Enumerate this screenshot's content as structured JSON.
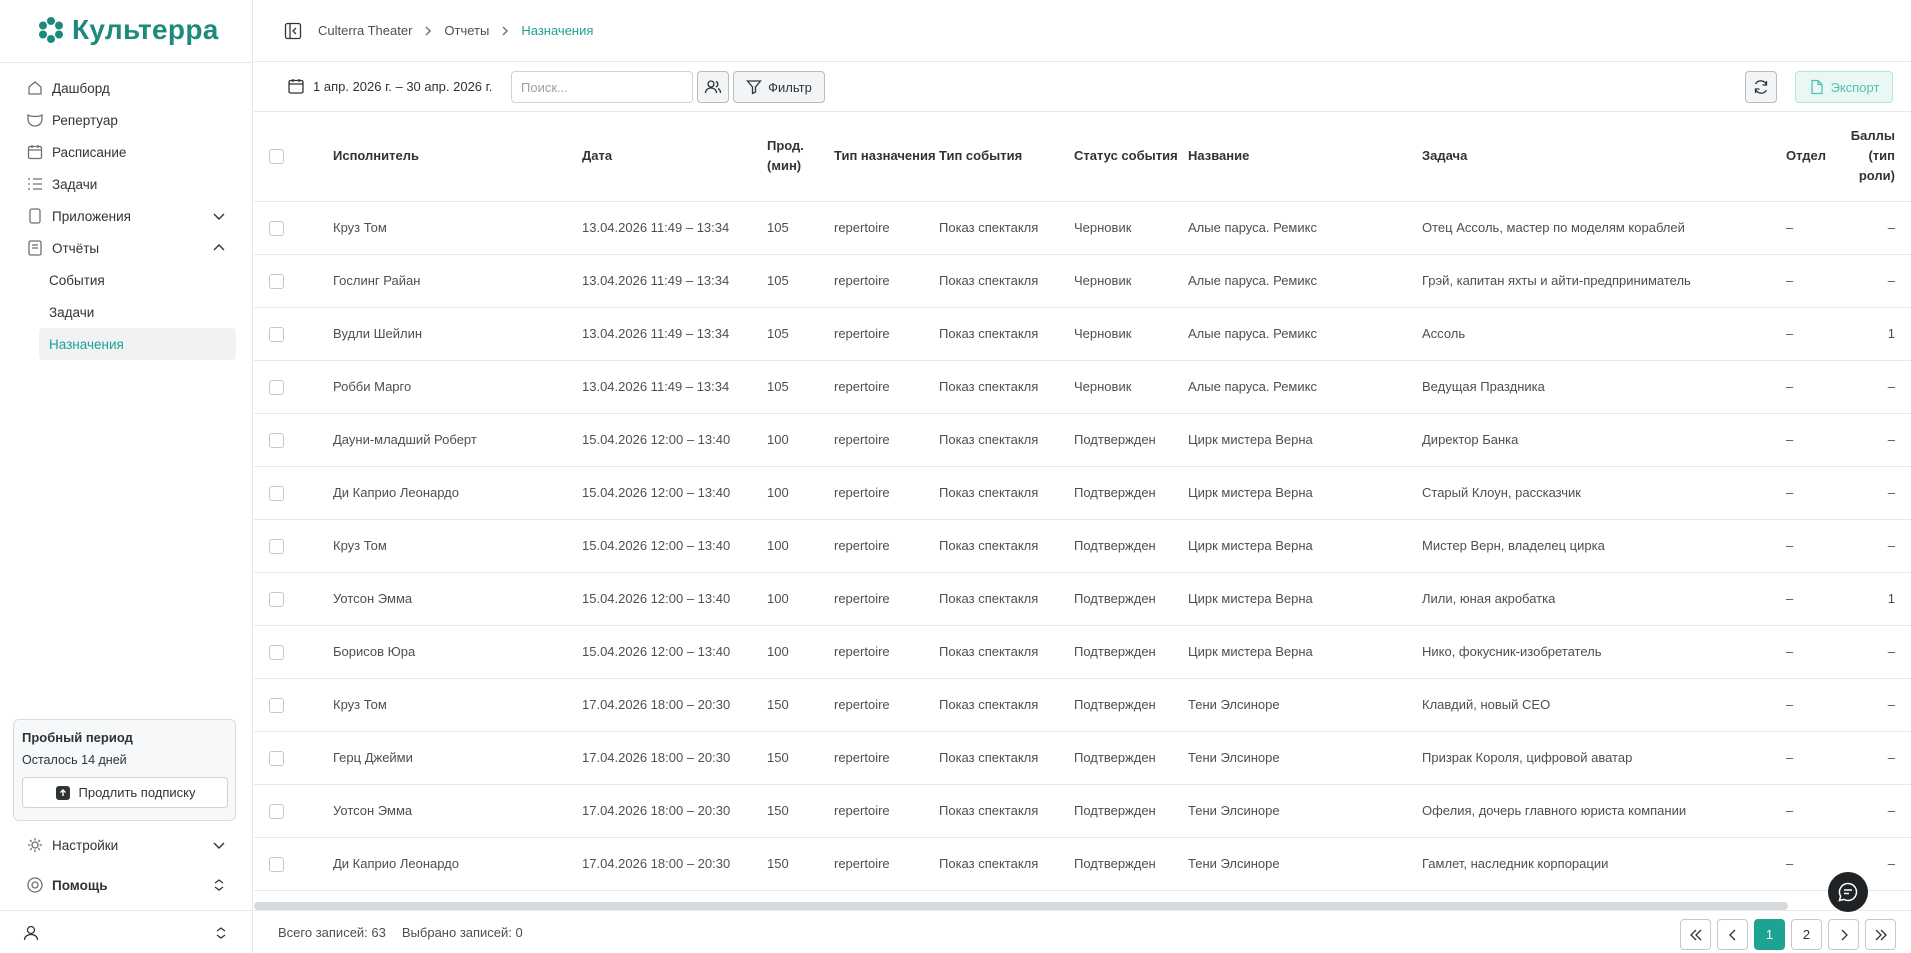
{
  "brand": {
    "name": "Культерра",
    "color": "#1e8a7c"
  },
  "sidebar": {
    "items": [
      {
        "label": "Дашборд",
        "icon": "home-icon"
      },
      {
        "label": "Репертуар",
        "icon": "theater-icon"
      },
      {
        "label": "Расписание",
        "icon": "calendar-icon"
      },
      {
        "label": "Задачи",
        "icon": "tasks-icon"
      },
      {
        "label": "Приложения",
        "icon": "app-icon"
      },
      {
        "label": "Отчёты",
        "icon": "report-icon"
      }
    ],
    "reports_sub": [
      {
        "label": "События"
      },
      {
        "label": "Задачи"
      },
      {
        "label": "Назначения"
      }
    ],
    "trial": {
      "title": "Пробный период",
      "days": "Осталось 14 дней",
      "button": "Продлить подписку"
    },
    "settings_label": "Настройки",
    "help_label": "Помощь"
  },
  "breadcrumb": [
    "Culterra Theater",
    "Отчеты",
    "Назначения"
  ],
  "toolbar": {
    "date_range": "1 апр. 2026 г. – 30 апр. 2026 г.",
    "search_placeholder": "Поиск...",
    "filter_label": "Фильтр",
    "export_label": "Экспорт"
  },
  "table": {
    "headers": {
      "performer": "Исполнитель",
      "date": "Дата",
      "duration": "Прод. (мин)",
      "assign_type": "Тип назначения",
      "event_type": "Тип события",
      "event_status": "Статус события",
      "name": "Название",
      "task": "Задача",
      "dept": "Отдел",
      "points": "Баллы (тип роли)"
    },
    "rows": [
      {
        "performer": "Круз Том",
        "date": "13.04.2026 11:49 – 13:34",
        "duration": "105",
        "assign_type": "repertoire",
        "event_type": "Показ спектакля",
        "event_status": "Черновик",
        "name": "Алые паруса. Ремикс",
        "task": "Отец Ассоль, мастер по моделям кораблей",
        "dept": "–",
        "points": "–"
      },
      {
        "performer": "Гослинг Райан",
        "date": "13.04.2026 11:49 – 13:34",
        "duration": "105",
        "assign_type": "repertoire",
        "event_type": "Показ спектакля",
        "event_status": "Черновик",
        "name": "Алые паруса. Ремикс",
        "task": "Грэй, капитан яхты и айти-предприниматель",
        "dept": "–",
        "points": "–"
      },
      {
        "performer": "Вудли Шейлин",
        "date": "13.04.2026 11:49 – 13:34",
        "duration": "105",
        "assign_type": "repertoire",
        "event_type": "Показ спектакля",
        "event_status": "Черновик",
        "name": "Алые паруса. Ремикс",
        "task": "Ассоль",
        "dept": "–",
        "points": "1"
      },
      {
        "performer": "Робби Марго",
        "date": "13.04.2026 11:49 – 13:34",
        "duration": "105",
        "assign_type": "repertoire",
        "event_type": "Показ спектакля",
        "event_status": "Черновик",
        "name": "Алые паруса. Ремикс",
        "task": "Ведущая Праздника",
        "dept": "–",
        "points": "–"
      },
      {
        "performer": "Дауни-младший Роберт",
        "date": "15.04.2026 12:00 – 13:40",
        "duration": "100",
        "assign_type": "repertoire",
        "event_type": "Показ спектакля",
        "event_status": "Подтвержден",
        "name": "Цирк мистера Верна",
        "task": "Директор Банка",
        "dept": "–",
        "points": "–"
      },
      {
        "performer": "Ди Каприо Леонардо",
        "date": "15.04.2026 12:00 – 13:40",
        "duration": "100",
        "assign_type": "repertoire",
        "event_type": "Показ спектакля",
        "event_status": "Подтвержден",
        "name": "Цирк мистера Верна",
        "task": "Старый Клоун, рассказчик",
        "dept": "–",
        "points": "–"
      },
      {
        "performer": "Круз Том",
        "date": "15.04.2026 12:00 – 13:40",
        "duration": "100",
        "assign_type": "repertoire",
        "event_type": "Показ спектакля",
        "event_status": "Подтвержден",
        "name": "Цирк мистера Верна",
        "task": "Мистер Верн, владелец цирка",
        "dept": "–",
        "points": "–"
      },
      {
        "performer": "Уотсон Эмма",
        "date": "15.04.2026 12:00 – 13:40",
        "duration": "100",
        "assign_type": "repertoire",
        "event_type": "Показ спектакля",
        "event_status": "Подтвержден",
        "name": "Цирк мистера Верна",
        "task": "Лили, юная акробатка",
        "dept": "–",
        "points": "1"
      },
      {
        "performer": "Борисов Юра",
        "date": "15.04.2026 12:00 – 13:40",
        "duration": "100",
        "assign_type": "repertoire",
        "event_type": "Показ спектакля",
        "event_status": "Подтвержден",
        "name": "Цирк мистера Верна",
        "task": "Нико, фокусник-изобретатель",
        "dept": "–",
        "points": "–"
      },
      {
        "performer": "Круз Том",
        "date": "17.04.2026 18:00 – 20:30",
        "duration": "150",
        "assign_type": "repertoire",
        "event_type": "Показ спектакля",
        "event_status": "Подтвержден",
        "name": "Тени Элсиноре",
        "task": "Клавдий, новый CEO",
        "dept": "–",
        "points": "–"
      },
      {
        "performer": "Герц Джейми",
        "date": "17.04.2026 18:00 – 20:30",
        "duration": "150",
        "assign_type": "repertoire",
        "event_type": "Показ спектакля",
        "event_status": "Подтвержден",
        "name": "Тени Элсиноре",
        "task": "Призрак Короля, цифровой аватар",
        "dept": "–",
        "points": "–"
      },
      {
        "performer": "Уотсон Эмма",
        "date": "17.04.2026 18:00 – 20:30",
        "duration": "150",
        "assign_type": "repertoire",
        "event_type": "Показ спектакля",
        "event_status": "Подтвержден",
        "name": "Тени Элсиноре",
        "task": "Офелия, дочерь главного юриста компании",
        "dept": "–",
        "points": "–"
      },
      {
        "performer": "Ди Каприо Леонардо",
        "date": "17.04.2026 18:00 – 20:30",
        "duration": "150",
        "assign_type": "repertoire",
        "event_type": "Показ спектакля",
        "event_status": "Подтвержден",
        "name": "Тени Элсиноре",
        "task": "Гамлет, наследник корпорации",
        "dept": "–",
        "points": "–"
      }
    ]
  },
  "footer": {
    "total": "Всего записей: 63",
    "selected": "Выбрано записей: 0",
    "pages": [
      "1",
      "2"
    ]
  },
  "colors": {
    "accent": "#1ea291",
    "text": "#2f3437"
  }
}
